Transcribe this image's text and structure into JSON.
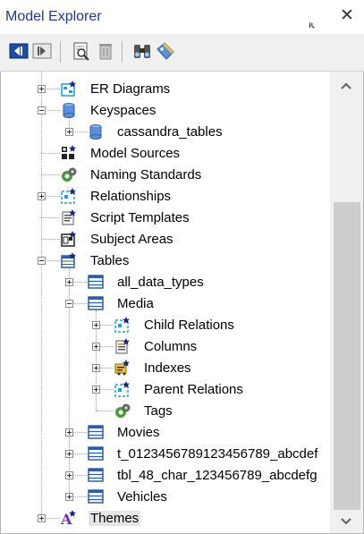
{
  "panel": {
    "title": "Model Explorer",
    "pin_icon": "pin-icon",
    "close_icon": "close-icon"
  },
  "toolbar": {
    "icons": [
      "move-previous-icon",
      "move-next-icon",
      "find-icon",
      "delete-icon",
      "binoculars-icon",
      "tag-icon"
    ]
  },
  "tree": {
    "nodes": [
      {
        "id": "er-diagrams",
        "label": "ER Diagrams",
        "icon": "er-diagram-icon",
        "expander": "plus",
        "level": 1
      },
      {
        "id": "keyspaces",
        "label": "Keyspaces",
        "icon": "keyspace-cylinder-icon",
        "expander": "minus",
        "level": 1
      },
      {
        "id": "cassandra-tables",
        "label": "cassandra_tables",
        "icon": "keyspace-cylinder-icon",
        "expander": "plus",
        "level": 2
      },
      {
        "id": "model-sources",
        "label": "Model Sources",
        "icon": "model-sources-icon",
        "expander": null,
        "level": 1
      },
      {
        "id": "naming-standards",
        "label": "Naming Standards",
        "icon": "naming-standards-icon",
        "expander": null,
        "level": 1
      },
      {
        "id": "relationships",
        "label": "Relationships",
        "icon": "relationship-icon",
        "expander": "plus",
        "level": 1
      },
      {
        "id": "script-templates",
        "label": "Script Templates",
        "icon": "script-template-icon",
        "expander": null,
        "level": 1
      },
      {
        "id": "subject-areas",
        "label": "Subject Areas",
        "icon": "subject-area-icon",
        "expander": null,
        "level": 1
      },
      {
        "id": "tables",
        "label": "Tables",
        "icon": "tables-folder-icon",
        "expander": "minus",
        "level": 1
      },
      {
        "id": "all-data-types",
        "label": "all_data_types",
        "icon": "table-icon",
        "expander": "plus",
        "level": 2
      },
      {
        "id": "media",
        "label": "Media",
        "icon": "table-icon",
        "expander": "minus",
        "level": 2
      },
      {
        "id": "child-relations",
        "label": "Child Relations",
        "icon": "relationship-icon",
        "expander": "plus",
        "level": 3
      },
      {
        "id": "columns",
        "label": "Columns",
        "icon": "columns-icon",
        "expander": "plus",
        "level": 3
      },
      {
        "id": "indexes",
        "label": "Indexes",
        "icon": "index-icon",
        "expander": "plus",
        "level": 3
      },
      {
        "id": "parent-relations",
        "label": "Parent Relations",
        "icon": "relationship-icon",
        "expander": "plus",
        "level": 3
      },
      {
        "id": "tags",
        "label": "Tags",
        "icon": "tag-gear-icon",
        "expander": null,
        "level": 3
      },
      {
        "id": "movies",
        "label": "Movies",
        "icon": "table-icon",
        "expander": "plus",
        "level": 2
      },
      {
        "id": "t-long",
        "label": "t_0123456789123456789_abcdef",
        "icon": "table-icon",
        "expander": "plus",
        "level": 2
      },
      {
        "id": "tbl-long",
        "label": "tbl_48_char_123456789_abcdefg",
        "icon": "table-icon",
        "expander": "plus",
        "level": 2
      },
      {
        "id": "vehicles",
        "label": "Vehicles",
        "icon": "table-icon",
        "expander": "plus",
        "level": 2
      },
      {
        "id": "themes",
        "label": "Themes",
        "icon": "themes-icon",
        "expander": "plus",
        "level": 1,
        "selected": true
      }
    ]
  },
  "scrollbar": {
    "up_icon": "scroll-up-arrow-icon",
    "down_icon": "scroll-down-arrow-icon"
  }
}
